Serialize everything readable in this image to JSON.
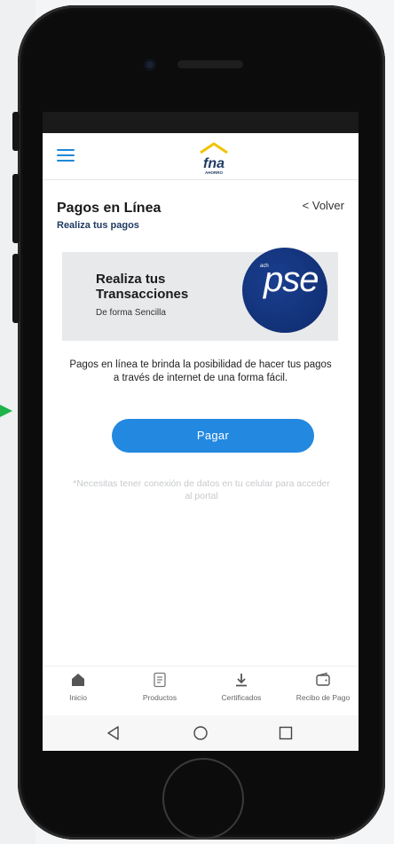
{
  "header": {
    "logo_text": "fna",
    "logo_sub": "AHORRO"
  },
  "page": {
    "title": "Pagos en Línea",
    "subtitle": "Realiza tus pagos",
    "back_label": "< Volver"
  },
  "banner": {
    "title_line1": "Realiza tus",
    "title_line2": "Transacciones",
    "subtitle": "De forma Sencilla",
    "pse_text": "pse",
    "pse_small": "ach"
  },
  "description": "Pagos en línea te brinda la posibilidad de hacer tus pagos a través de internet de una forma fácil.",
  "pay_button_label": "Pagar",
  "notice": "*Necesitas tener conexión de datos en tu celular para acceder al portal",
  "bottom_nav": {
    "items": [
      {
        "label": "Inicio",
        "icon": "home-icon"
      },
      {
        "label": "Productos",
        "icon": "document-icon"
      },
      {
        "label": "Certificados",
        "icon": "download-icon"
      },
      {
        "label": "Recibo de Pago",
        "icon": "wallet-icon"
      }
    ]
  },
  "system_nav": {
    "icons": [
      "back-icon",
      "home-circle-icon",
      "recents-icon"
    ]
  },
  "colors": {
    "primary": "#2388e0",
    "title": "#1f3b63",
    "pse_blue": "#0d2a6c",
    "accent_yellow": "#f2c200"
  }
}
